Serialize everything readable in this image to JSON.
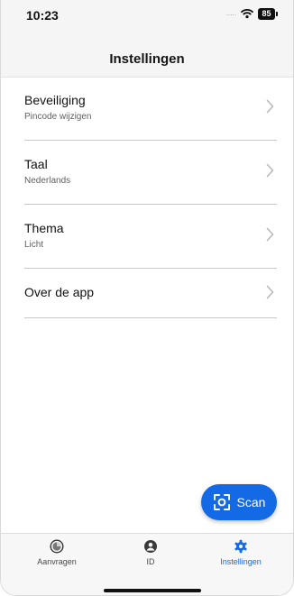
{
  "status_bar": {
    "time": "10:23",
    "signal": ".....",
    "battery": "85"
  },
  "header": {
    "title": "Instellingen"
  },
  "settings": [
    {
      "title": "Beveiliging",
      "subtitle": "Pincode wijzigen"
    },
    {
      "title": "Taal",
      "subtitle": "Nederlands"
    },
    {
      "title": "Thema",
      "subtitle": "Licht"
    },
    {
      "title": "Over de app"
    }
  ],
  "fab": {
    "label": "Scan",
    "icon": "scan-icon"
  },
  "bottom_nav": {
    "items": [
      {
        "label": "Aanvragen",
        "icon": "requests-icon",
        "active": false
      },
      {
        "label": "ID",
        "icon": "user-icon",
        "active": false
      },
      {
        "label": "Instellingen",
        "icon": "gear-icon",
        "active": true
      }
    ]
  },
  "colors": {
    "accent": "#1469e4",
    "header_bg": "#f5f5f5",
    "divider": "#c8c8c8"
  }
}
